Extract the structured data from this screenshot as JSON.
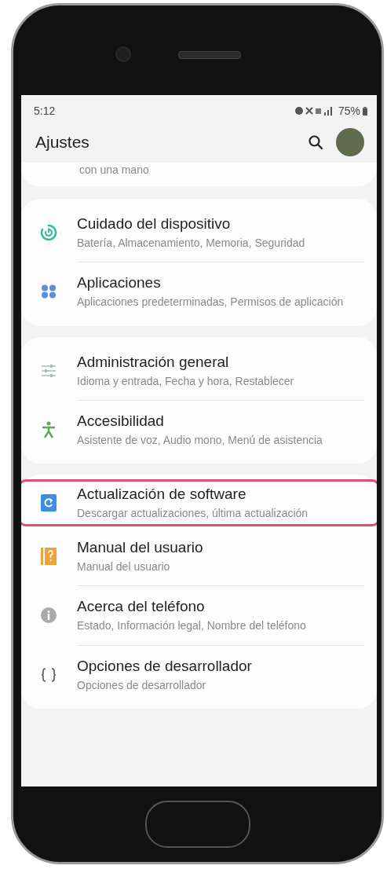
{
  "status_bar": {
    "time": "5:12",
    "battery": "75%"
  },
  "header": {
    "title": "Ajustes"
  },
  "partial_item": {
    "subtitle": "con una mano"
  },
  "groups": [
    {
      "items": [
        {
          "kind": "device-care",
          "title": "Cuidado del dispositivo",
          "subtitle": "Batería, Almacenamiento, Memoria, Seguridad",
          "highlighted": false
        },
        {
          "kind": "apps",
          "title": "Aplicaciones",
          "subtitle": "Aplicaciones predeterminadas, Permisos de aplicación",
          "highlighted": false
        }
      ]
    },
    {
      "items": [
        {
          "kind": "general",
          "title": "Administración general",
          "subtitle": "Idioma y entrada, Fecha y hora, Restablecer",
          "highlighted": false
        },
        {
          "kind": "accessibility",
          "title": "Accesibilidad",
          "subtitle": "Asistente de voz, Audio mono, Menú de asistencia",
          "highlighted": false
        }
      ]
    },
    {
      "items": [
        {
          "kind": "update",
          "title": "Actualización de software",
          "subtitle": "Descargar actualizaciones, última actualización",
          "highlighted": true
        },
        {
          "kind": "manual",
          "title": "Manual del usuario",
          "subtitle": "Manual del usuario",
          "highlighted": false
        },
        {
          "kind": "about",
          "title": "Acerca del teléfono",
          "subtitle": "Estado, Información legal, Nombre del teléfono",
          "highlighted": false
        },
        {
          "kind": "developer",
          "title": "Opciones de desarrollador",
          "subtitle": "Opciones de desarrollador",
          "highlighted": false
        }
      ]
    }
  ]
}
